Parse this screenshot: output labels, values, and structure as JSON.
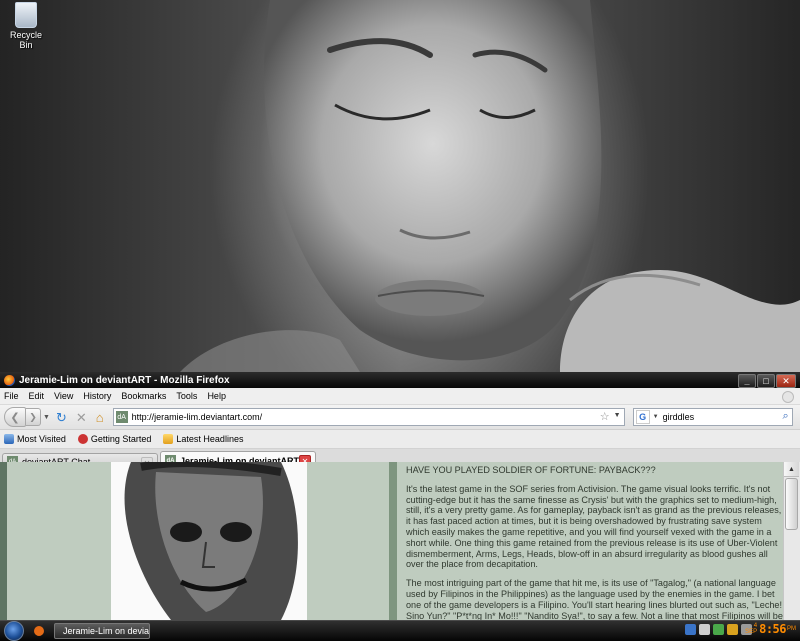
{
  "desktop": {
    "icons": [
      {
        "label": "Recycle Bin",
        "icon": "recycle-bin-icon"
      }
    ]
  },
  "window": {
    "title": "Jeramie-Lim on deviantART - Mozilla Firefox",
    "controls": {
      "minimize": "_",
      "maximize": "□",
      "close": "✕"
    }
  },
  "menu": {
    "items": [
      "File",
      "Edit",
      "View",
      "History",
      "Bookmarks",
      "Tools",
      "Help"
    ]
  },
  "navbar": {
    "url": "http://jeramie-lim.deviantart.com/",
    "search_value": "girddles",
    "search_engine_icon": "G"
  },
  "bookmarks": {
    "items": [
      {
        "label": "Most Visited",
        "icon": "most-visited-icon"
      },
      {
        "label": "Getting Started",
        "icon": "getting-started-icon"
      },
      {
        "label": "Latest Headlines",
        "icon": "rss-folder-icon"
      }
    ]
  },
  "tabs": [
    {
      "label": "deviantART Chat",
      "active": false
    },
    {
      "label": "Jeramie-Lim on deviantART",
      "active": true
    }
  ],
  "article": {
    "title": "HAVE YOU PLAYED SOLDIER OF FORTUNE: PAYBACK???",
    "paragraphs": [
      "It's the latest game in the SOF series from Activision. The game visual looks terrific. It's not cutting-edge but it has the same finesse as Crysis' but with the graphics set to medium-high, still, it's a very pretty game. As for gameplay, payback isn't as grand as the previous releases, it has fast paced action at times, but it is being overshadowed by frustrating save system which easily makes the game repetitive, and you will find yourself vexed with the game in a short while. One thing this game retained from the previous release is its use of Uber-Violent dismemberment, Arms, Legs, Heads, blow-off in an absurd irregularity as blood gushes all over the place from decapitation.",
      "The most intriguing part of the game that hit me, is its use of \"Tagalog,\" (a national language used by Filipinos in the Philippines) as the language used by the enemies in the game. I bet one of the game developers is a Filipino. You'll start hearing lines blurted out such as, \"Leche! Sino Yun?\" \"P*t*ng In* Mo!!!\" \"Nandito Sya!\", to say a few. Not a line that most Filipinos will be proud of really, but, I am somehow astounded and a sense of"
    ]
  },
  "taskbar": {
    "window_item": "Jeramie-Lim on devian...",
    "clock": {
      "time": "8:56",
      "ampm": "PM",
      "day": "4",
      "month": "SEP"
    }
  }
}
